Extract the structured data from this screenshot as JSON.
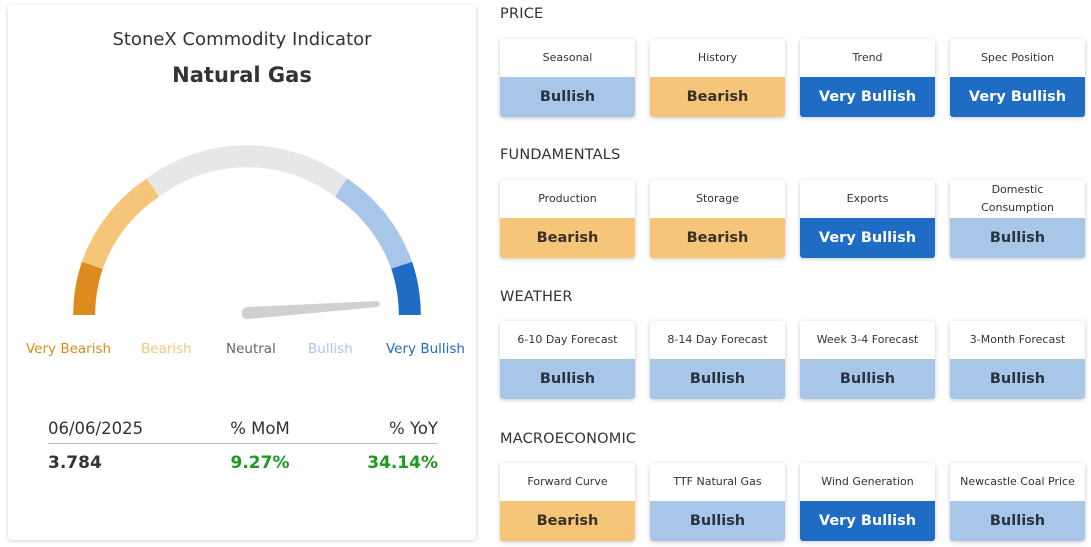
{
  "indicator": {
    "subtitle": "StoneX Commodity Indicator",
    "title": "Natural Gas",
    "gauge": {
      "level": "Very Bullish",
      "labels": [
        "Very Bearish",
        "Bearish",
        "Neutral",
        "Bullish",
        "Very Bullish"
      ],
      "colors": {
        "very_bearish": "#dd8b1e",
        "bearish": "#f5c57a",
        "neutral": "#e6e7e6",
        "bullish": "#a8c6e8",
        "very_bullish": "#1f6cc4",
        "needle": "#d0d0d0"
      }
    },
    "stats": {
      "headers": [
        "06/06/2025",
        "% MoM",
        "% YoY"
      ],
      "values": [
        "3.784",
        "9.27%",
        "34.14%"
      ]
    }
  },
  "sections": [
    {
      "title": "PRICE",
      "tiles": [
        {
          "label": "Seasonal",
          "value": "Bullish"
        },
        {
          "label": "History",
          "value": "Bearish"
        },
        {
          "label": "Trend",
          "value": "Very Bullish"
        },
        {
          "label": "Spec Position",
          "value": "Very Bullish"
        }
      ]
    },
    {
      "title": "FUNDAMENTALS",
      "tiles": [
        {
          "label": "Production",
          "value": "Bearish"
        },
        {
          "label": "Storage",
          "value": "Bearish"
        },
        {
          "label": "Exports",
          "value": "Very Bullish"
        },
        {
          "label": "Domestic Consumption",
          "value": "Bullish"
        }
      ]
    },
    {
      "title": "WEATHER",
      "tiles": [
        {
          "label": "6-10 Day Forecast",
          "value": "Bullish"
        },
        {
          "label": "8-14 Day Forecast",
          "value": "Bullish"
        },
        {
          "label": "Week 3-4 Forecast",
          "value": "Bullish"
        },
        {
          "label": "3-Month Forecast",
          "value": "Bullish"
        }
      ]
    },
    {
      "title": "MACROECONOMIC",
      "tiles": [
        {
          "label": "Forward Curve",
          "value": "Bearish"
        },
        {
          "label": "TTF Natural Gas",
          "value": "Bullish"
        },
        {
          "label": "Wind Generation",
          "value": "Very Bullish"
        },
        {
          "label": "Newcastle Coal Price",
          "value": "Bullish"
        }
      ]
    }
  ]
}
